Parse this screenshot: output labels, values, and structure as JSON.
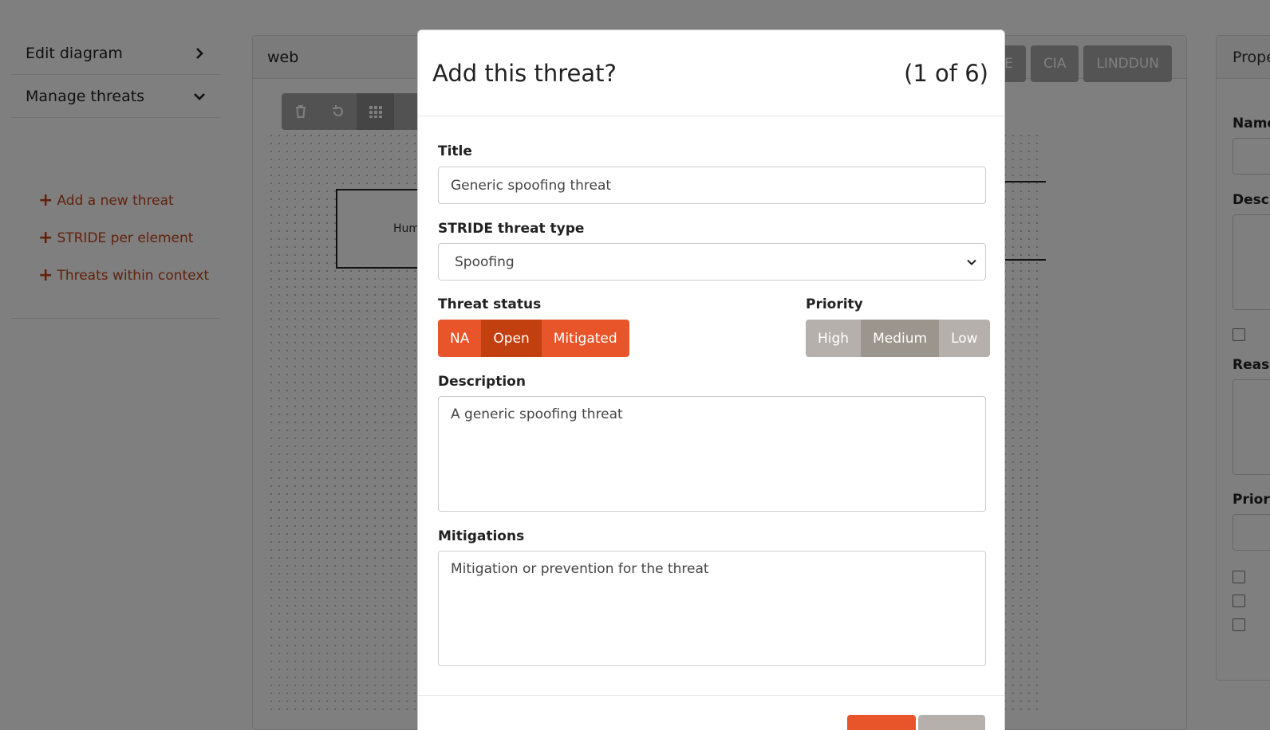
{
  "sidebar": {
    "edit_diagram": "Edit diagram",
    "manage_threats": "Manage threats",
    "actions": [
      {
        "label": "Add a new threat"
      },
      {
        "label": "STRIDE per element"
      },
      {
        "label": "Threats within context"
      }
    ]
  },
  "diagram": {
    "title": "web",
    "frameworks": [
      "STRIDE",
      "CIA",
      "LINDDUN"
    ],
    "box_label": "Human"
  },
  "properties": {
    "title": "Properties",
    "labels": [
      "Name",
      "Description",
      "Reason",
      "Priority"
    ]
  },
  "modal": {
    "title": "Add this threat?",
    "counter": "(1 of 6)",
    "title_label": "Title",
    "title_value": "Generic spoofing threat",
    "type_label": "STRIDE threat type",
    "type_value": "Spoofing",
    "status_label": "Threat status",
    "status_options": [
      "NA",
      "Open",
      "Mitigated"
    ],
    "status_selected": "Open",
    "priority_label": "Priority",
    "priority_options": [
      "High",
      "Medium",
      "Low"
    ],
    "priority_selected": "Medium",
    "description_label": "Description",
    "description_value": "A generic spoofing threat",
    "mitigations_label": "Mitigations",
    "mitigations_value": "Mitigation or prevention for the threat"
  },
  "colors": {
    "accent": "#e8552a",
    "accent_active": "#c24010",
    "link": "#c0451b",
    "priority": "#b5b0ab",
    "priority_active": "#9c958e"
  },
  "icons": [
    "chevron-right-icon",
    "chevron-down-icon",
    "plus-icon",
    "trash-icon",
    "undo-icon",
    "grid-icon",
    "select-chevron-icon"
  ]
}
